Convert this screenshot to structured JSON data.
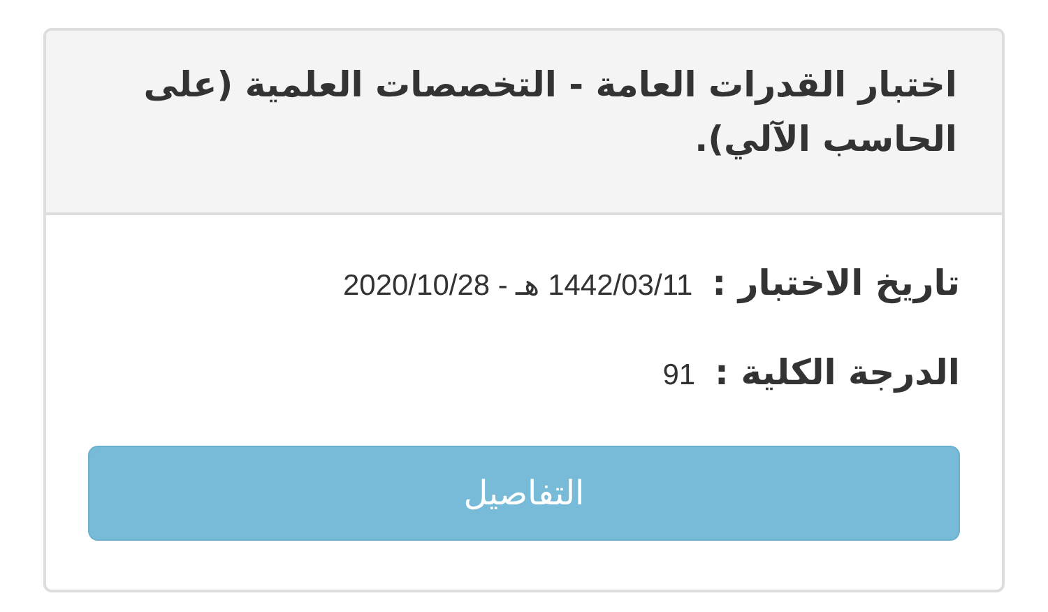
{
  "card": {
    "title": "اختبار القدرات العامة - التخصصات العلمية (على الحاسب الآلي).",
    "fields": [
      {
        "label": "تاريخ الاختبار :",
        "value": "1442/03/11 هـ - 2020/10/28"
      },
      {
        "label": "الدرجة الكلية :",
        "value": "91"
      }
    ],
    "button": "التفاصيل"
  }
}
